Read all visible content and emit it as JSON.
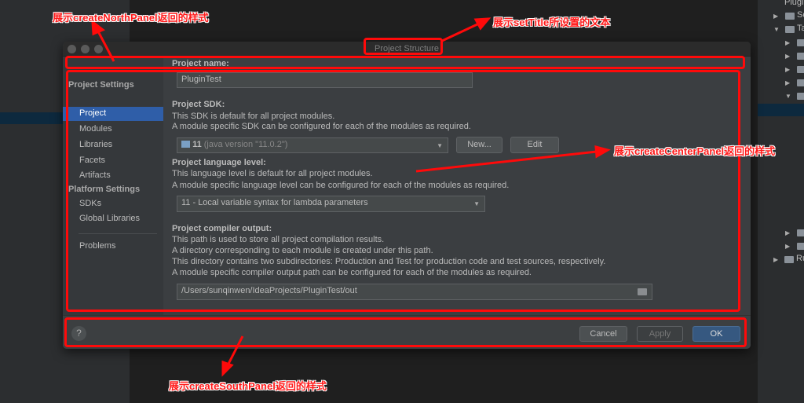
{
  "dialog": {
    "title": "Project Structure"
  },
  "sidebar": {
    "project_settings_header": "Project Settings",
    "items": [
      "Project",
      "Modules",
      "Libraries",
      "Facets",
      "Artifacts"
    ],
    "platform_settings_header": "Platform Settings",
    "platform_items": [
      "SDKs",
      "Global Libraries"
    ],
    "problems": "Problems",
    "selected": "Project"
  },
  "main": {
    "project_name": {
      "label": "Project name:",
      "value": "PluginTest"
    },
    "sdk": {
      "label": "Project SDK:",
      "desc1": "This SDK is default for all project modules.",
      "desc2": "A module specific SDK can be configured for each of the modules as required.",
      "selected_bold": "11",
      "selected_rest": "(java version \"11.0.2\")",
      "new_button": "New...",
      "edit_button": "Edit"
    },
    "language": {
      "label": "Project language level:",
      "desc1": "This language level is default for all project modules.",
      "desc2": "A module specific language level can be configured for each of the modules as required.",
      "selected": "11 - Local variable syntax for lambda parameters"
    },
    "compiler": {
      "label": "Project compiler output:",
      "desc1": "This path is used to store all project compilation results.",
      "desc2": "A directory corresponding to each module is created under this path.",
      "desc3": "This directory contains two subdirectories: Production and Test for production code and test sources, respectively.",
      "desc4": "A module specific compiler output path can be configured for each of the modules as required.",
      "path": "/Users/sunqinwen/IdeaProjects/PluginTest/out"
    }
  },
  "south": {
    "help": "?",
    "cancel": "Cancel",
    "apply": "Apply",
    "ok": "OK"
  },
  "project_tree": {
    "items": [
      "Plugi",
      "Sc",
      "Ta",
      "Ru"
    ]
  },
  "annotations": {
    "north": "展示createNorthPanel返回的样式",
    "title": "展示setTitle所设置的文本",
    "center": "展示createCenterPanel返回的样式",
    "south": "展示createSouthPanel返回的样式"
  },
  "colors": {
    "annotation": "#ff0a0a",
    "selection": "#2f5ea8",
    "ok_button": "#365880"
  }
}
